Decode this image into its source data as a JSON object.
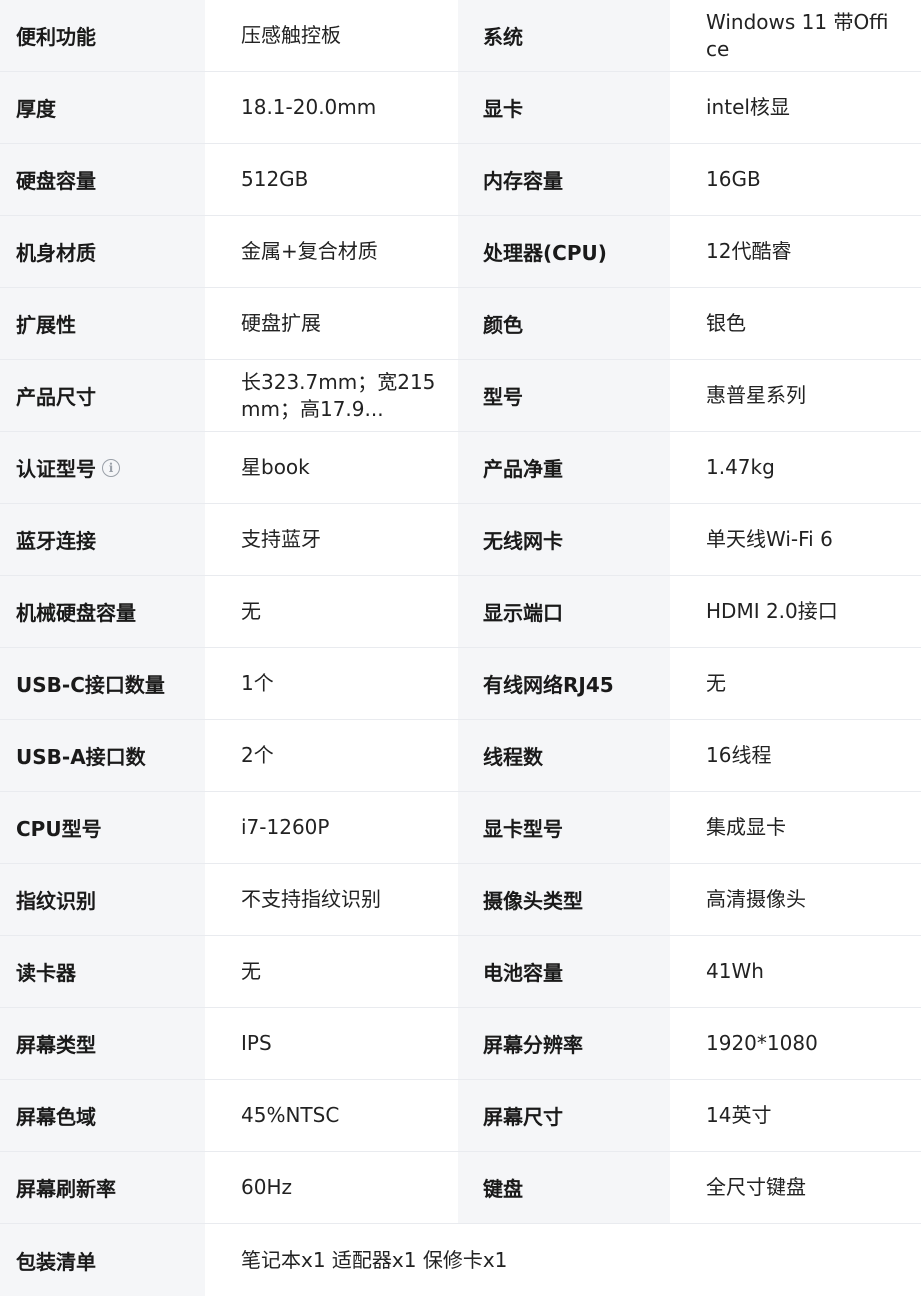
{
  "specs": {
    "rows": [
      {
        "l1": "便利功能",
        "v1": "压感触控板",
        "l2": "系统",
        "v2": "Windows 11 带Office"
      },
      {
        "l1": "厚度",
        "v1": "18.1-20.0mm",
        "l2": "显卡",
        "v2": "intel核显"
      },
      {
        "l1": "硬盘容量",
        "v1": "512GB",
        "l2": "内存容量",
        "v2": "16GB"
      },
      {
        "l1": "机身材质",
        "v1": "金属+复合材质",
        "l2": "处理器(CPU)",
        "v2": "12代酷睿"
      },
      {
        "l1": "扩展性",
        "v1": "硬盘扩展",
        "l2": "颜色",
        "v2": "银色"
      },
      {
        "l1": "产品尺寸",
        "v1": "长323.7mm；宽215mm；高17.9...",
        "l2": "型号",
        "v2": "惠普星系列"
      },
      {
        "l1": "认证型号",
        "v1": "星book",
        "l2": "产品净重",
        "v2": "1.47kg",
        "info_icon": "info-circle-icon"
      },
      {
        "l1": "蓝牙连接",
        "v1": "支持蓝牙",
        "l2": "无线网卡",
        "v2": "单天线Wi-Fi 6"
      },
      {
        "l1": "机械硬盘容量",
        "v1": "无",
        "l2": "显示端口",
        "v2": "HDMI 2.0接口"
      },
      {
        "l1": "USB-C接口数量",
        "v1": "1个",
        "l2": "有线网络RJ45",
        "v2": "无"
      },
      {
        "l1": "USB-A接口数",
        "v1": "2个",
        "l2": "线程数",
        "v2": "16线程"
      },
      {
        "l1": "CPU型号",
        "v1": "i7-1260P",
        "l2": "显卡型号",
        "v2": "集成显卡"
      },
      {
        "l1": "指纹识别",
        "v1": "不支持指纹识别",
        "l2": "摄像头类型",
        "v2": "高清摄像头"
      },
      {
        "l1": "读卡器",
        "v1": "无",
        "l2": "电池容量",
        "v2": "41Wh"
      },
      {
        "l1": "屏幕类型",
        "v1": "IPS",
        "l2": "屏幕分辨率",
        "v2": "1920*1080"
      },
      {
        "l1": "屏幕色域",
        "v1": "45%NTSC",
        "l2": "屏幕尺寸",
        "v2": "14英寸"
      },
      {
        "l1": "屏幕刷新率",
        "v1": "60Hz",
        "l2": "键盘",
        "v2": "全尺寸键盘"
      }
    ],
    "last": {
      "label": "包装清单",
      "value": "笔记本x1 适配器x1 保修卡x1"
    }
  },
  "colors": {
    "label_bg": "#f5f6f8",
    "value_bg": "#ffffff",
    "divider": "#e9ebef"
  }
}
